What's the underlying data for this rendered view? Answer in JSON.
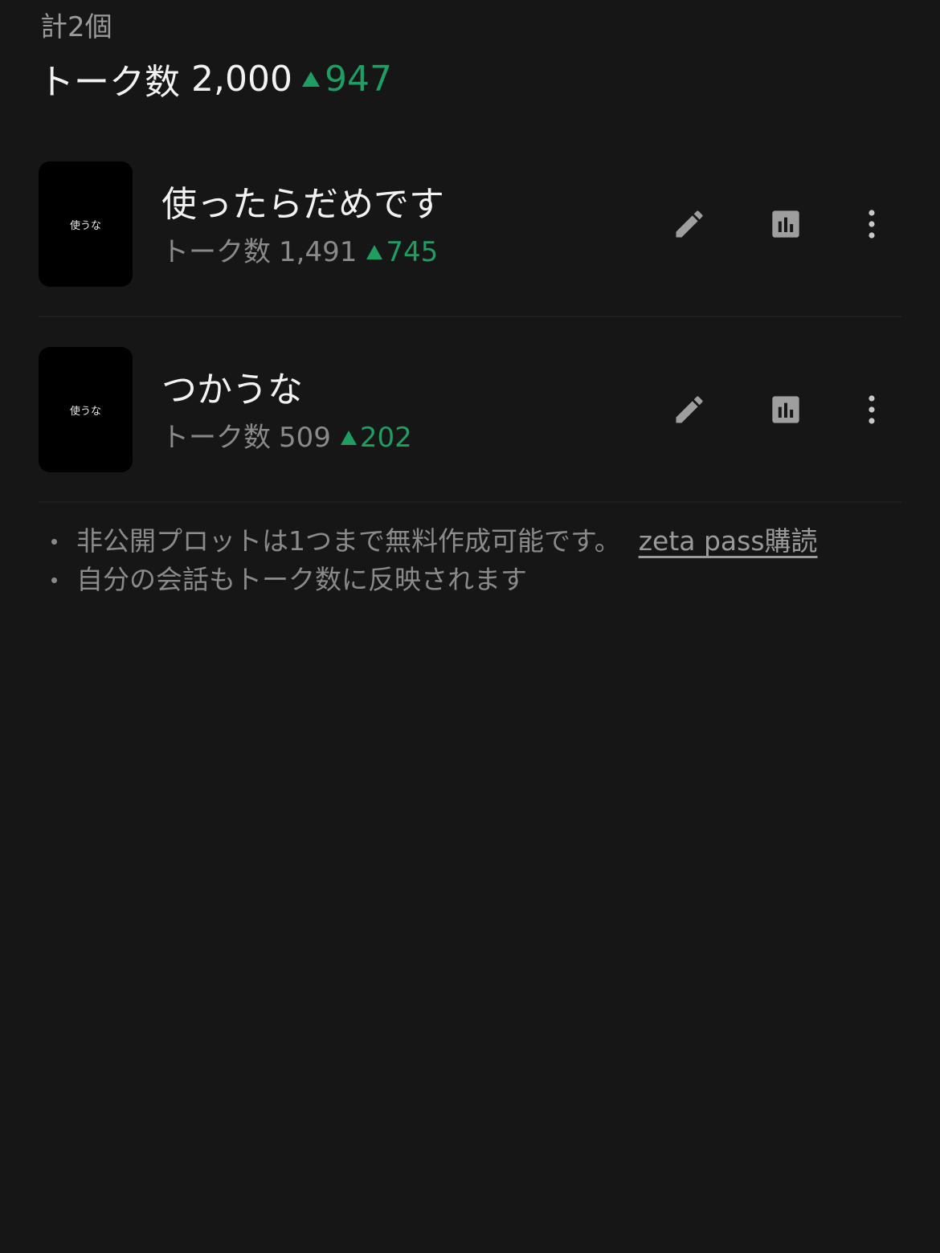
{
  "summary": {
    "count_label": "計2個",
    "talk_label": "トーク数",
    "total_talks": "2,000",
    "total_delta": "947"
  },
  "plots": [
    {
      "thumbnail_text": "使うな",
      "title": "使ったらだめです",
      "talk_label": "トーク数",
      "talks": "1,491",
      "delta": "745"
    },
    {
      "thumbnail_text": "使うな",
      "title": "つかうな",
      "talk_label": "トーク数",
      "talks": "509",
      "delta": "202"
    }
  ],
  "notes": {
    "private_limit": "非公開プロットは1つまで無料作成可能です。",
    "subscribe_link": "zeta pass購読",
    "own_chat_note": "自分の会話もトーク数に反映されます"
  },
  "icons": {
    "edit": "pencil-icon",
    "stats": "bar-chart-icon",
    "more": "more-vertical-icon"
  },
  "colors": {
    "background": "#161616",
    "positive_delta": "#1f9d62",
    "muted_text": "#8a8a8a",
    "icon": "#9e9e9e"
  }
}
